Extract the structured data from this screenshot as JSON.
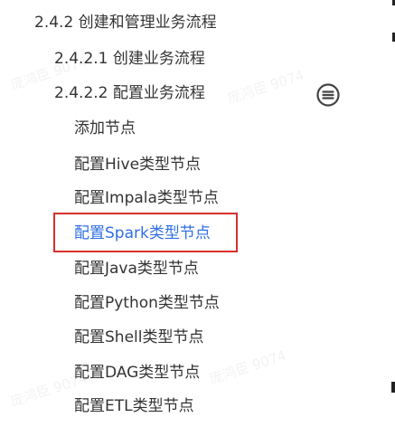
{
  "toc": {
    "items": [
      {
        "label": "2.4.2 创建和管理业务流程",
        "level": 1,
        "active": false
      },
      {
        "label": "2.4.2.1 创建业务流程",
        "level": 2,
        "active": false
      },
      {
        "label": "2.4.2.2 配置业务流程",
        "level": 2,
        "active": false
      },
      {
        "label": "添加节点",
        "level": 3,
        "active": false
      },
      {
        "label": "配置Hive类型节点",
        "level": 3,
        "active": false
      },
      {
        "label": "配置Impala类型节点",
        "level": 3,
        "active": false
      },
      {
        "label": "配置Spark类型节点",
        "level": 3,
        "active": true
      },
      {
        "label": "配置Java类型节点",
        "level": 3,
        "active": false
      },
      {
        "label": "配置Python类型节点",
        "level": 3,
        "active": false
      },
      {
        "label": "配置Shell类型节点",
        "level": 3,
        "active": false
      },
      {
        "label": "配置DAG类型节点",
        "level": 3,
        "active": false
      },
      {
        "label": "配置ETL类型节点",
        "level": 3,
        "active": false
      }
    ],
    "collapse_icon": "collapse-icon"
  },
  "watermark": "庞鸿臣 9074",
  "colors": {
    "text": "#333333",
    "active_text": "#2f6fe6",
    "highlight_border": "#d9302c"
  }
}
